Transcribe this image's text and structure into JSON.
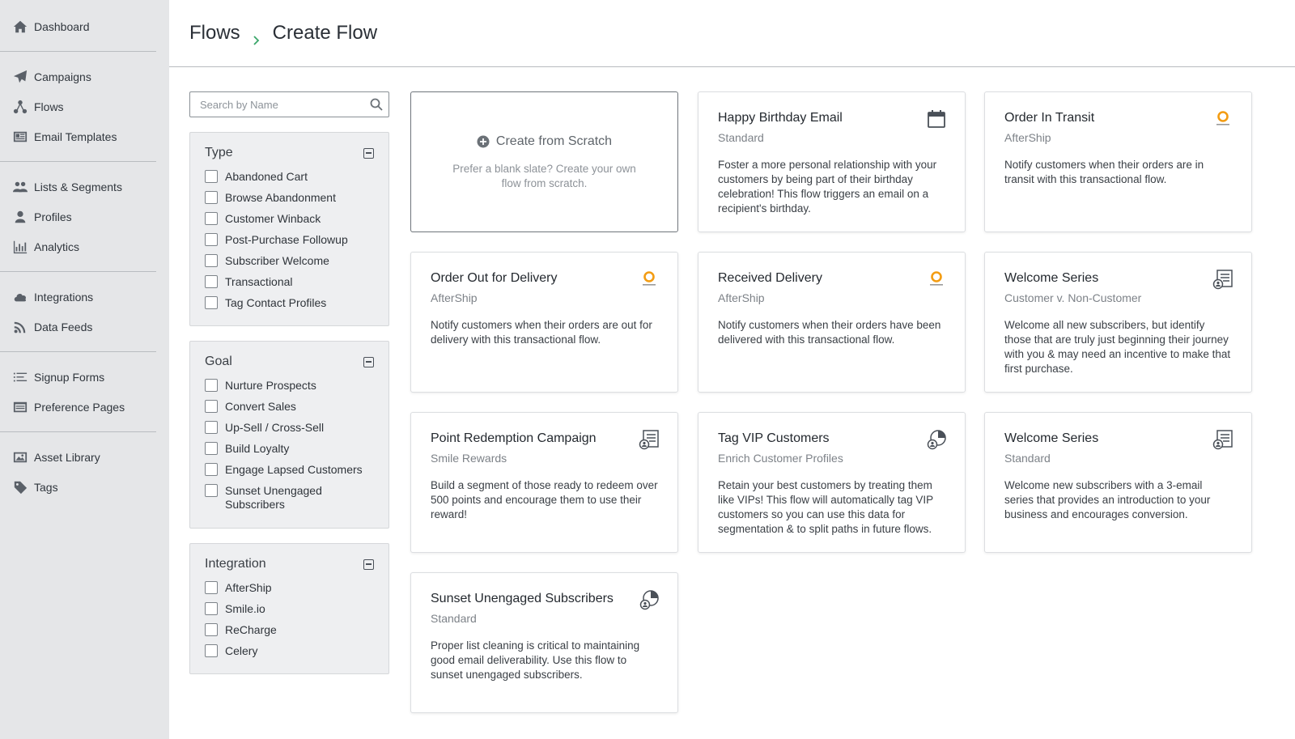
{
  "sidebar": {
    "groups": [
      [
        {
          "label": "Dashboard",
          "icon": "home-icon"
        }
      ],
      [
        {
          "label": "Campaigns",
          "icon": "paper-plane-icon"
        },
        {
          "label": "Flows",
          "icon": "flows-icon"
        },
        {
          "label": "Email Templates",
          "icon": "template-icon"
        }
      ],
      [
        {
          "label": "Lists & Segments",
          "icon": "users-icon"
        },
        {
          "label": "Profiles",
          "icon": "user-icon"
        },
        {
          "label": "Analytics",
          "icon": "bar-chart-icon"
        }
      ],
      [
        {
          "label": "Integrations",
          "icon": "cloud-icon"
        },
        {
          "label": "Data Feeds",
          "icon": "rss-icon"
        }
      ],
      [
        {
          "label": "Signup Forms",
          "icon": "form-icon"
        },
        {
          "label": "Preference Pages",
          "icon": "preference-icon"
        }
      ],
      [
        {
          "label": "Asset Library",
          "icon": "image-icon"
        },
        {
          "label": "Tags",
          "icon": "tag-icon"
        }
      ]
    ]
  },
  "header": {
    "crumb_root": "Flows",
    "crumb_current": "Create Flow"
  },
  "search": {
    "placeholder": "Search by Name",
    "value": ""
  },
  "filters": {
    "type": {
      "title": "Type",
      "options": [
        "Abandoned Cart",
        "Browse Abandonment",
        "Customer Winback",
        "Post-Purchase Followup",
        "Subscriber Welcome",
        "Transactional",
        "Tag Contact Profiles"
      ]
    },
    "goal": {
      "title": "Goal",
      "options": [
        "Nurture Prospects",
        "Convert Sales",
        "Up-Sell / Cross-Sell",
        "Build Loyalty",
        "Engage Lapsed Customers",
        "Sunset Unengaged Subscribers"
      ]
    },
    "integration": {
      "title": "Integration",
      "options": [
        "AfterShip",
        "Smile.io",
        "ReCharge",
        "Celery"
      ]
    }
  },
  "scratch": {
    "title": "Create from Scratch",
    "desc": "Prefer a blank slate? Create your own flow from scratch."
  },
  "cards": [
    {
      "title": "Happy Birthday Email",
      "subtitle": "Standard",
      "desc": "Foster a more personal relationship with your customers by being part of their birthday celebration! This flow triggers an email on a recipient's birthday.",
      "icon": "calendar-icon"
    },
    {
      "title": "Order In Transit",
      "subtitle": "AfterShip",
      "desc": "Notify customers when their orders are in transit with this transactional flow.",
      "icon": "aftership-logo-icon"
    },
    {
      "title": "Order Out for Delivery",
      "subtitle": "AfterShip",
      "desc": "Notify customers when their orders are out for delivery with this transactional flow.",
      "icon": "aftership-logo-icon"
    },
    {
      "title": "Received Delivery",
      "subtitle": "AfterShip",
      "desc": "Notify customers when their orders have been delivered with this transactional flow.",
      "icon": "aftership-logo-icon"
    },
    {
      "title": "Welcome Series",
      "subtitle": "Customer v. Non-Customer",
      "desc": "Welcome all new subscribers, but identify those that are truly just beginning their journey with you & may need an incentive to make that first purchase.",
      "icon": "list-user-icon"
    },
    {
      "title": "Point Redemption Campaign",
      "subtitle": "Smile Rewards",
      "desc": "Build a segment of those ready to redeem over 500 points and encourage them to use their reward!",
      "icon": "list-user-icon"
    },
    {
      "title": "Tag VIP Customers",
      "subtitle": "Enrich Customer Profiles",
      "desc": "Retain your best customers by treating them like VIPs! This flow will automatically tag VIP customers so you can use this data for segmentation & to split paths in future flows.",
      "icon": "pie-user-icon"
    },
    {
      "title": "Welcome Series",
      "subtitle": "Standard",
      "desc": "Welcome new subscribers with a 3-email series that provides an introduction to your business and encourages conversion.",
      "icon": "list-user-icon"
    },
    {
      "title": "Sunset Unengaged Subscribers",
      "subtitle": "Standard",
      "desc": "Proper list cleaning is critical to maintaining good email deliverability. Use this flow to sunset unengaged subscribers.",
      "icon": "pie-user-icon"
    }
  ],
  "colors": {
    "sidebar_bg": "#e5e6e8",
    "accent_green": "#3aa66a",
    "aftership_orange": "#f39c12",
    "text_dark": "#2a2f36"
  }
}
